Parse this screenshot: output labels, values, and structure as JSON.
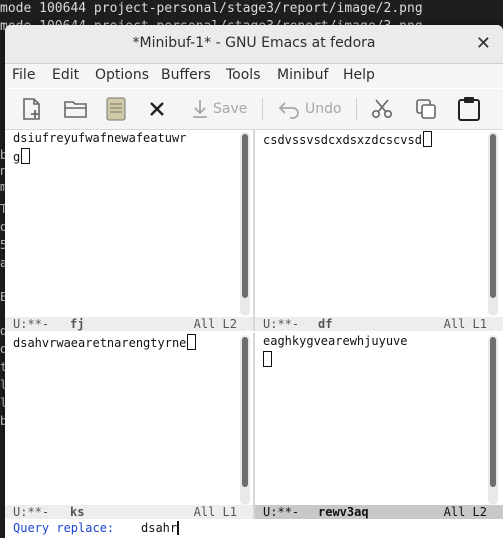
{
  "terminal": {
    "line1": "mode 100644 project-personal/stage3/report/image/2.png",
    "line2": "mode 100644 project-personal/stage3/report/image/3.png",
    "fragments": [
      "b",
      "n",
      "m",
      "T",
      "o",
      "5",
      "a",
      "E",
      "d",
      "o",
      "t",
      "l",
      "l",
      "b"
    ]
  },
  "window": {
    "title": "*Minibuf-1* - GNU Emacs at fedora",
    "close": "✕"
  },
  "menubar": [
    "File",
    "Edit",
    "Options",
    "Buffers",
    "Tools",
    "Minibuf",
    "Help"
  ],
  "toolbar": {
    "new_file": "new-file-icon",
    "open": "folder-open-icon",
    "save_disk": "disk-icon",
    "close": "close-buffer-icon",
    "save_label": "Save",
    "undo_label": "Undo",
    "cut": "scissors-icon",
    "copy": "copy-icon",
    "paste": "paste-icon"
  },
  "panes": {
    "top_left": {
      "line1": "dsiufreyufwafnewafeatuwr",
      "line2": "g",
      "modeline": {
        "state": "U:**-",
        "name": "fj",
        "pos": "All L2"
      }
    },
    "top_right": {
      "line1": "csdvssvsdcxdsxzdcscvsd",
      "modeline": {
        "state": "U:**-",
        "name": "df",
        "pos": "All L1"
      }
    },
    "bottom_left": {
      "line1": "dsahvrwaearetnarengtyrne",
      "modeline": {
        "state": "U:**-",
        "name": "ks",
        "pos": "All L1"
      }
    },
    "bottom_right": {
      "line1": "eaghkygvearewhjuyuve",
      "modeline": {
        "state": "U:**-",
        "name": "rewv3aq",
        "pos": "All L2"
      }
    }
  },
  "minibuffer": {
    "prompt": "Query replace:",
    "input": "dsahr"
  }
}
